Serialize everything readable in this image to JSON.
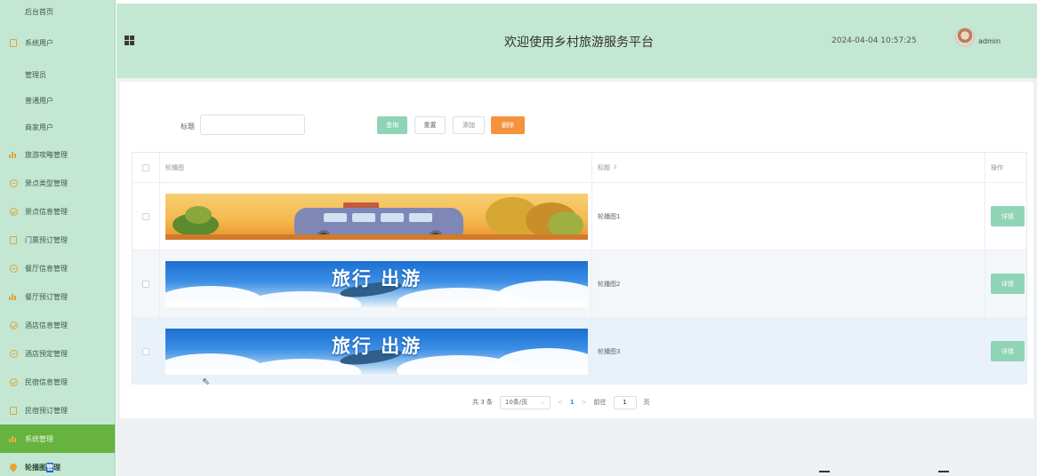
{
  "sidebar": {
    "items": [
      {
        "label": "后台首页",
        "icon": "none"
      },
      {
        "label": "系统用户",
        "icon": "document-icon"
      },
      {
        "label": "管理员",
        "icon": "none"
      },
      {
        "label": "普通用户",
        "icon": "none"
      },
      {
        "label": "商家用户",
        "icon": "none"
      },
      {
        "label": "旅游攻略管理",
        "icon": "bar-chart-icon"
      },
      {
        "label": "景点类型管理",
        "icon": "chat-icon"
      },
      {
        "label": "景点信息管理",
        "icon": "check-circle-icon"
      },
      {
        "label": "门票预订管理",
        "icon": "document-icon"
      },
      {
        "label": "餐厅信息管理",
        "icon": "chat-icon"
      },
      {
        "label": "餐厅预订管理",
        "icon": "bar-chart-icon"
      },
      {
        "label": "酒店信息管理",
        "icon": "check-circle-icon"
      },
      {
        "label": "酒店预定管理",
        "icon": "chat-icon"
      },
      {
        "label": "民宿信息管理",
        "icon": "check-circle-icon"
      },
      {
        "label": "民宿预订管理",
        "icon": "document-icon"
      },
      {
        "label": "系统管理",
        "icon": "bar-chart-icon"
      },
      {
        "label_a": "轮播图",
        "label_b": "管",
        "label_c": "理",
        "icon": "pin-icon"
      }
    ]
  },
  "header": {
    "title": "欢迎使用乡村旅游服务平台",
    "datetime": "2024-04-04 10:57:25",
    "username": "admin"
  },
  "search": {
    "label": "标题",
    "value": "",
    "placeholder": ""
  },
  "toolbar": {
    "query_label": "查询",
    "reset_label": "重置",
    "add_label": "添加",
    "delete_label": "删除"
  },
  "table": {
    "headers": {
      "image": "轮播图",
      "title": "标题",
      "sort_icon": "⇕",
      "actions": "操作"
    },
    "rows": [
      {
        "title": "轮播图1",
        "image": "autumn-bus-banner",
        "action": "详情"
      },
      {
        "title": "轮播图2",
        "image": "travel-banner",
        "banner_text": "旅行 出游",
        "action": "详情"
      },
      {
        "title": "轮播图3",
        "image": "travel-banner",
        "banner_text": "旅行 出游",
        "action": "详情"
      }
    ]
  },
  "pagination": {
    "total": "共 3 条",
    "page_size": "10条/页",
    "prev": "<",
    "current": "1",
    "next": ">",
    "goto_prefix": "前往",
    "goto_value": "1",
    "goto_suffix": "页"
  },
  "colors": {
    "sidebar_bg": "#c3e7d3",
    "header_bg": "#c3e7d3",
    "active_menu": "#67b33f",
    "primary_button": "#8fd4b6",
    "danger_button": "#f5923e"
  }
}
